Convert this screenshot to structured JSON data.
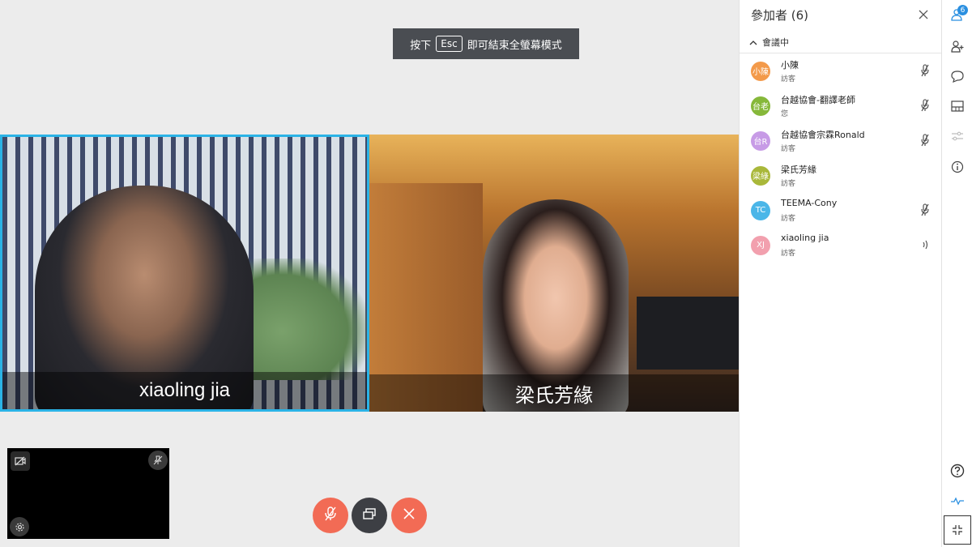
{
  "stage": {
    "esc_hint_before": "按下",
    "esc_key": "Esc",
    "esc_hint_after": "即可結束全螢幕模式",
    "videos": [
      {
        "caption": "xiaoling jia",
        "active": true
      },
      {
        "caption": "梁氏芳緣",
        "active": false
      }
    ]
  },
  "selfview": {
    "icons": [
      "camera-off-icon",
      "pin-off-icon",
      "gear-icon"
    ]
  },
  "controls": [
    {
      "name": "mute-button",
      "icon": "mic-off-icon",
      "color": "#f26b55"
    },
    {
      "name": "share-screen-button",
      "icon": "screens-icon",
      "color": "#3d3f44"
    },
    {
      "name": "leave-button",
      "icon": "close-icon",
      "color": "#f26b55"
    }
  ],
  "panel": {
    "title": "參加者 (6)",
    "section_label": "會議中",
    "participants": [
      {
        "initials": "小陳",
        "name": "小陳",
        "role": "訪客",
        "color": "#f39a4a",
        "audio": "muted"
      },
      {
        "initials": "台老",
        "name": "台越協會-翻譯老師",
        "role": "您",
        "color": "#86b83a",
        "audio": "muted"
      },
      {
        "initials": "台R",
        "name": "台越協會宗霖Ronald",
        "role": "訪客",
        "color": "#c79be6",
        "audio": "muted"
      },
      {
        "initials": "梁綠",
        "name": "梁氏芳緣",
        "role": "訪客",
        "color": "#a9b83a",
        "audio": "none"
      },
      {
        "initials": "TC",
        "name": "TEEMA-Cony",
        "role": "訪客",
        "color": "#4bb6e8",
        "audio": "muted"
      },
      {
        "initials": "XJ",
        "name": "xiaoling jia",
        "role": "訪客",
        "color": "#f2a0ae",
        "audio": "speaking"
      }
    ]
  },
  "rail": {
    "participants_badge": "6",
    "colors": {
      "active": "#2a8fe0",
      "muted": "#bbbbbb"
    }
  }
}
